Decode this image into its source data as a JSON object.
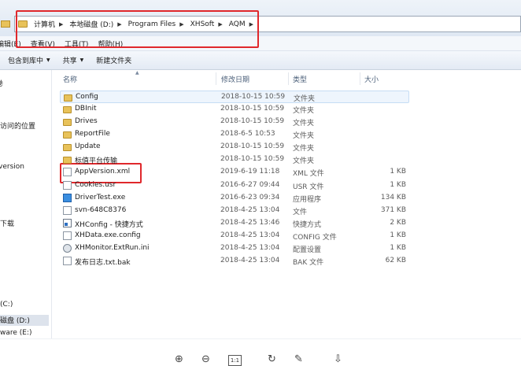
{
  "address": {
    "crumbs": [
      "计算机",
      "本地磁盘 (D:)",
      "Program Files",
      "XHSoft",
      "AQM"
    ]
  },
  "menubar": {
    "items": [
      "编辑(E)",
      "查看(V)",
      "工具(T)",
      "帮助(H)"
    ]
  },
  "toolbar": {
    "include_library": "包含到库中",
    "share": "共享",
    "new_folder": "新建文件夹"
  },
  "nav": {
    "items": [
      "卷",
      "访问的位置",
      "version",
      "下载",
      "(C:)",
      "磁盘 (D:)",
      "ware (E:)"
    ]
  },
  "columns": {
    "name": "名称",
    "date": "修改日期",
    "type": "类型",
    "size": "大小"
  },
  "files": [
    {
      "name": "Config",
      "date": "2018-10-15 10:59",
      "type": "文件夹",
      "size": "",
      "icon": "folder-icon"
    },
    {
      "name": "DBInit",
      "date": "2018-10-15 10:59",
      "type": "文件夹",
      "size": "",
      "icon": "folder-icon"
    },
    {
      "name": "Drives",
      "date": "2018-10-15 10:59",
      "type": "文件夹",
      "size": "",
      "icon": "folder-icon"
    },
    {
      "name": "ReportFile",
      "date": "2018-6-5 10:53",
      "type": "文件夹",
      "size": "",
      "icon": "folder-icon"
    },
    {
      "name": "Update",
      "date": "2018-10-15 10:59",
      "type": "文件夹",
      "size": "",
      "icon": "folder-icon"
    },
    {
      "name": "标值平台传输",
      "date": "2018-10-15 10:59",
      "type": "文件夹",
      "size": "",
      "icon": "folder-icon"
    },
    {
      "name": "AppVersion.xml",
      "date": "2019-6-19 11:18",
      "type": "XML 文件",
      "size": "1 KB",
      "icon": "xml-file-icon"
    },
    {
      "name": "Cookies.usr",
      "date": "2016-6-27 09:44",
      "type": "USR 文件",
      "size": "1 KB",
      "icon": "file-icon"
    },
    {
      "name": "DriverTest.exe",
      "date": "2016-6-23 09:34",
      "type": "应用程序",
      "size": "134 KB",
      "icon": "exe-icon"
    },
    {
      "name": "svn-648C8376",
      "date": "2018-4-25 13:04",
      "type": "文件",
      "size": "371 KB",
      "icon": "file-icon"
    },
    {
      "name": "XHConfig - 快捷方式",
      "date": "2018-4-25 13:46",
      "type": "快捷方式",
      "size": "2 KB",
      "icon": "shortcut-icon"
    },
    {
      "name": "XHData.exe.config",
      "date": "2018-4-25 13:04",
      "type": "CONFIG 文件",
      "size": "1 KB",
      "icon": "file-icon"
    },
    {
      "name": "XHMonitor.ExtRun.ini",
      "date": "2018-4-25 13:04",
      "type": "配置设置",
      "size": "1 KB",
      "icon": "ini-gear-icon"
    },
    {
      "name": "发布日志.txt.bak",
      "date": "2018-4-25 13:04",
      "type": "BAK 文件",
      "size": "62 KB",
      "icon": "file-icon"
    }
  ],
  "viewer": {
    "zoom_in": "⊕",
    "zoom_out": "⊖",
    "actual_size": "1:1",
    "rotate": "↻",
    "edit": "✎",
    "download": "⇩"
  },
  "colors": {
    "highlight": "#e0282c",
    "hover": "#eef5fd"
  }
}
